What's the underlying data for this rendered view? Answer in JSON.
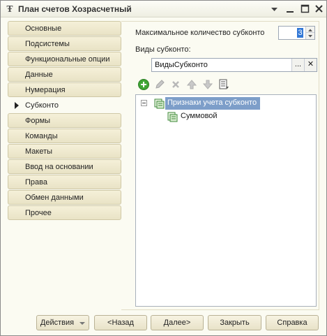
{
  "window": {
    "title": "План счетов Хозрасчетный"
  },
  "tabs": [
    {
      "label": "Основные",
      "active": false
    },
    {
      "label": "Подсистемы",
      "active": false
    },
    {
      "label": "Функциональные опции",
      "active": false
    },
    {
      "label": "Данные",
      "active": false
    },
    {
      "label": "Нумерация",
      "active": false
    },
    {
      "label": "Субконто",
      "active": true
    },
    {
      "label": "Формы",
      "active": false
    },
    {
      "label": "Команды",
      "active": false
    },
    {
      "label": "Макеты",
      "active": false
    },
    {
      "label": "Ввод на основании",
      "active": false
    },
    {
      "label": "Права",
      "active": false
    },
    {
      "label": "Обмен данными",
      "active": false
    },
    {
      "label": "Прочее",
      "active": false
    }
  ],
  "subconto": {
    "max_count_label": "Максимальное количество субконто",
    "max_count_value": "3",
    "types_label": "Виды субконто:",
    "types_value": "ВидыСубконто",
    "select_button": "...",
    "clear_button": "✕"
  },
  "toolbar": {
    "icons": [
      "add-icon",
      "edit-icon",
      "delete-icon",
      "move-up-icon",
      "move-down-icon",
      "list-icon"
    ]
  },
  "tree": {
    "root": "Признаки учета субконто",
    "children": [
      "Суммовой"
    ]
  },
  "buttons": {
    "actions": "Действия",
    "back": "<Назад",
    "next": "Далее>",
    "close": "Закрыть",
    "help": "Справка"
  },
  "colors": {
    "window_bg": "#fbfbf2",
    "tab_bg": "#efe9cf",
    "selection": "#7d9ec9",
    "add_icon": "#3fa535"
  }
}
